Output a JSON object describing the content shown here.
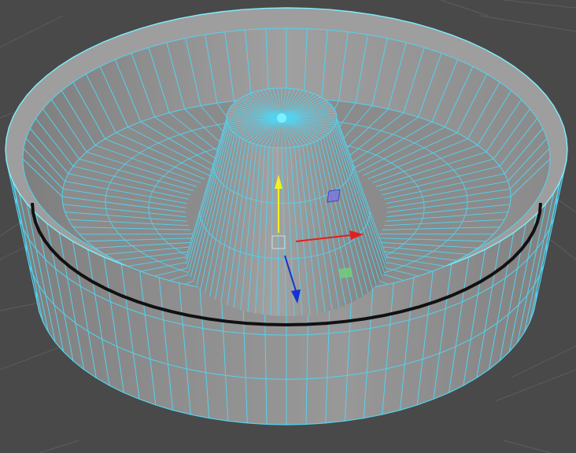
{
  "viewport": {
    "background_color": "#494949",
    "ground_grid_color": "#5a5a5a",
    "mesh_face_color": "#8c8c8c",
    "wireframe_color": "#53d3f0",
    "selection_highlight_color": "#7cf0ff",
    "tool": "move-tool",
    "selected_object": "ring-mold-mesh"
  },
  "manipulator": {
    "x_axis_color": "#e02020",
    "y_axis_color": "#f2f21e",
    "z_axis_color": "#1a2fd0",
    "xy_plane_handle_color": "#7a74e0",
    "xz_plane_handle_color": "#6ed27a",
    "center_handle_color": "#d0d0d0"
  }
}
